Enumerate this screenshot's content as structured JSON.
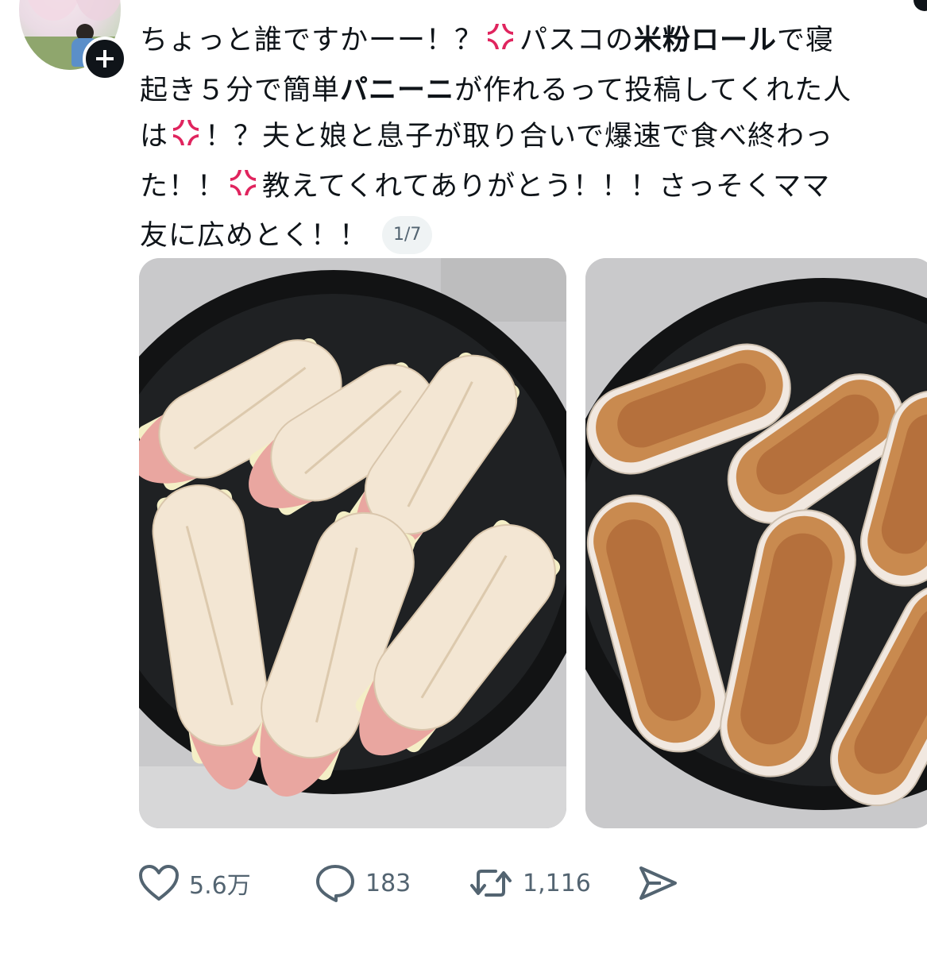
{
  "post": {
    "lines": [
      [
        "ちょっと誰ですかーー！？",
        "{anger}",
        "パスコの",
        "<b>米粉ロール</b>",
        "で寝"
      ],
      [
        "起き５分で簡単",
        "<b>パニーニ</b>",
        "が作れるって投稿してくれた人"
      ],
      [
        "は",
        "{anger}",
        "！？夫と娘と息子が取り合いで爆速で食べ終わっ"
      ],
      [
        "た！！",
        "{anger}",
        "教えてくれてありがとう！！！さっそくママ"
      ],
      [
        "友に広めとく！！"
      ]
    ],
    "image_counter": "1/7"
  },
  "actions": {
    "likes": "5.6万",
    "replies": "183",
    "reposts": "1,116"
  },
  "icons": {
    "follow": "plus-icon",
    "anger": "anger-symbol-icon",
    "like": "heart-icon",
    "reply": "reply-bubble-icon",
    "repost": "repost-icon",
    "share": "share-icon"
  },
  "colors": {
    "text": "#0f1419",
    "muted": "#536471",
    "anger": "#e0245e"
  }
}
